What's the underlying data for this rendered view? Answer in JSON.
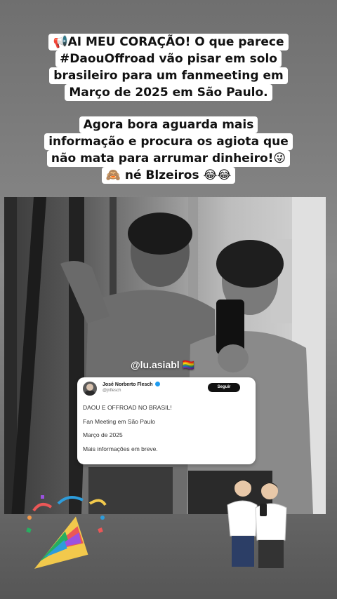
{
  "caption": {
    "lines_part1": [
      "📢AI MEU CORAÇÃO! O que parece",
      "#DaouOffroad vão pisar em solo",
      "brasileiro para um fanmeeting em",
      "Março de 2025 em São Paulo."
    ],
    "lines_part2": [
      "Agora bora aguarda mais",
      "informação e procura os agiota que",
      "não mata para arrumar dinheiro!😜",
      "🙈 né Blzeiros 😂😂"
    ]
  },
  "watermark": "@lu.asiabl 🏳️‍🌈",
  "tweet": {
    "author_name": "José Norberto Flesch",
    "author_handle": "@jnflesch",
    "follow_label": "Seguir",
    "lines": [
      "DAOU E OFFROAD NO BRASIL!",
      "Fan Meeting em São Paulo",
      "Março de 2025",
      "Mais informações em breve."
    ]
  },
  "stickers": {
    "party": "party-popper-sticker",
    "couple": "couple-illustration-sticker"
  },
  "colors": {
    "caption_bg": "#ffffff",
    "follow_button": "#111111",
    "verified_badge": "#1d9bf0"
  }
}
